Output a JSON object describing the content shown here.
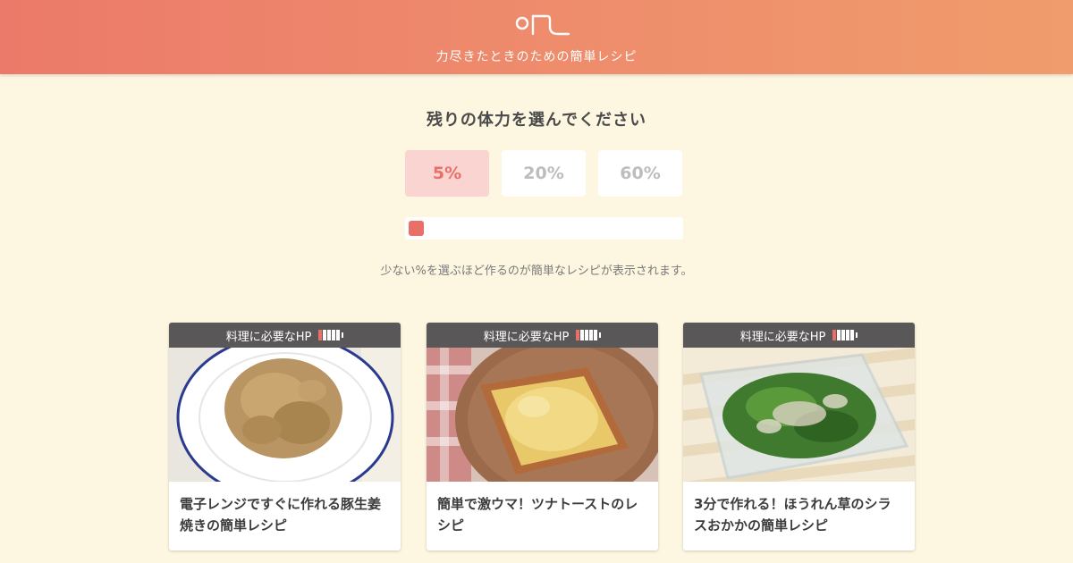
{
  "header": {
    "tagline": "力尽きたときのための簡単レシピ",
    "logo": "logo-mark",
    "colors": {
      "gradient_start": "#ec7a6a",
      "gradient_end": "#f09c6c"
    }
  },
  "selector": {
    "prompt": "残りの体力を選んでください",
    "options": [
      {
        "label": "5%",
        "selected": true
      },
      {
        "label": "20%",
        "selected": false
      },
      {
        "label": "60%",
        "selected": false
      }
    ],
    "slider_value_percent": 5,
    "hint": "少ない%を選ぶほど作るのが簡単なレシピが表示されます。",
    "accent_color": "#e87068"
  },
  "cards": [
    {
      "badge_label": "料理に必要なHP",
      "hp_cells_filled": 1,
      "hp_cells_total": 5,
      "title": "電子レンジですぐに作れる豚生姜焼きの簡単レシピ",
      "image": "pork-ginger-plate"
    },
    {
      "badge_label": "料理に必要なHP",
      "hp_cells_filled": 1,
      "hp_cells_total": 5,
      "title": "簡単で激ウマ！ツナトーストのレシピ",
      "image": "tuna-toast-plate"
    },
    {
      "badge_label": "料理に必要なHP",
      "hp_cells_filled": 1,
      "hp_cells_total": 5,
      "title": "3分で作れる！ほうれん草のシラスおかかの簡単レシピ",
      "image": "spinach-shirasu-container"
    }
  ]
}
